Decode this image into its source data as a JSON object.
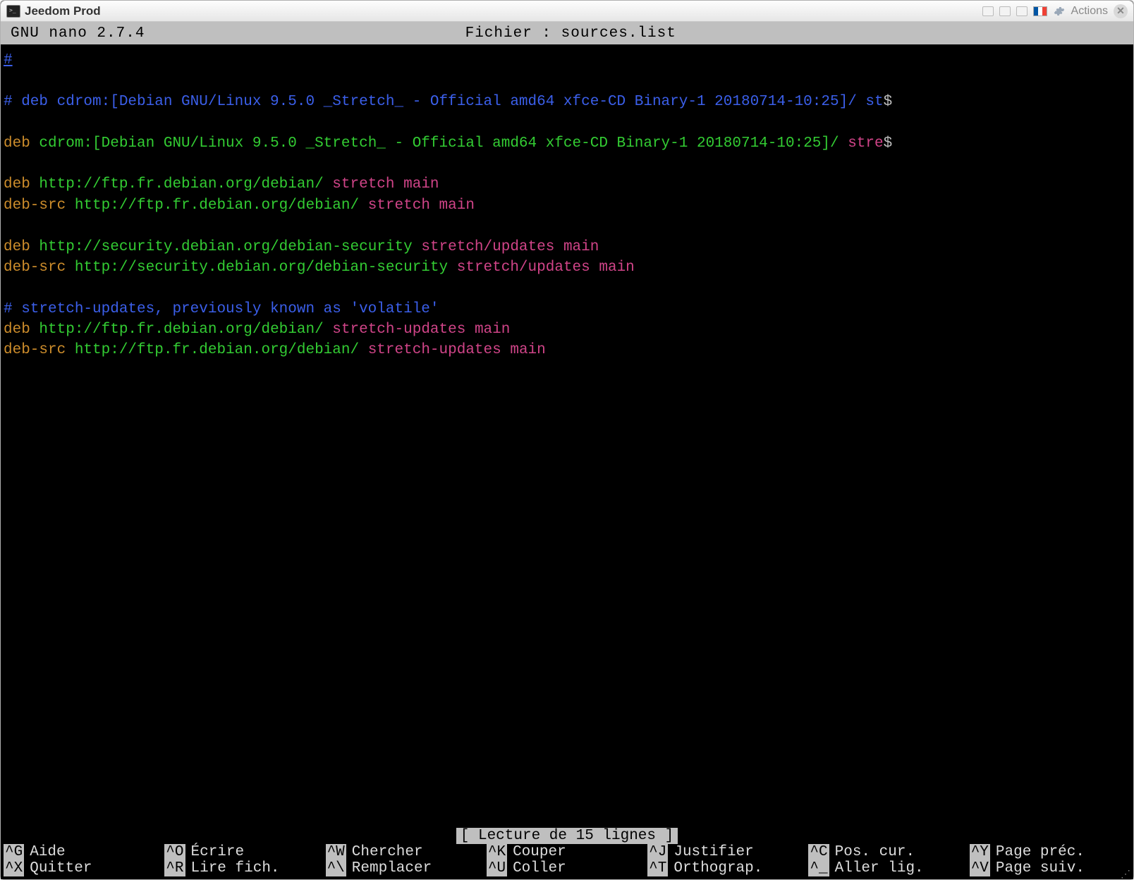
{
  "window": {
    "title": "Jeedom Prod",
    "actions_label": "Actions"
  },
  "nano": {
    "app": "  GNU nano 2.7.4",
    "file_label": "Fichier : sources.list"
  },
  "file_content": {
    "lines": [
      {
        "type": "comment-uline",
        "text": "#"
      },
      {
        "type": "blank",
        "text": ""
      },
      {
        "type": "comment",
        "text": "# deb cdrom:[Debian GNU/Linux 9.5.0 _Stretch_ - Official amd64 xfce-CD Binary-1 20180714-10:25]/ st",
        "trunc": "$"
      },
      {
        "type": "blank",
        "text": ""
      },
      {
        "type": "deb",
        "deb": "deb",
        "args": " cdrom:[Debian GNU/Linux 9.5.0 _Stretch_ - Official amd64 xfce-CD Binary-1 20180714-10:25]/ ",
        "dist": "stre",
        "trunc": "$"
      },
      {
        "type": "blank",
        "text": ""
      },
      {
        "type": "deb",
        "deb": "deb",
        "args": " http://ftp.fr.debian.org/debian/ ",
        "dist": "stretch ",
        "comp": "main"
      },
      {
        "type": "deb",
        "deb": "deb-src",
        "args": " http://ftp.fr.debian.org/debian/ ",
        "dist": "stretch ",
        "comp": "main"
      },
      {
        "type": "blank",
        "text": ""
      },
      {
        "type": "deb",
        "deb": "deb",
        "args": " http://security.debian.org/debian-security ",
        "dist": "stretch/updates ",
        "comp": "main"
      },
      {
        "type": "deb",
        "deb": "deb-src",
        "args": " http://security.debian.org/debian-security ",
        "dist": "stretch/updates ",
        "comp": "main"
      },
      {
        "type": "blank",
        "text": ""
      },
      {
        "type": "comment",
        "text": "# stretch-updates, previously known as 'volatile'"
      },
      {
        "type": "deb",
        "deb": "deb",
        "args": " http://ftp.fr.debian.org/debian/ ",
        "dist": "stretch-updates ",
        "comp": "main"
      },
      {
        "type": "deb",
        "deb": "deb-src",
        "args": " http://ftp.fr.debian.org/debian/ ",
        "dist": "stretch-updates ",
        "comp": "main"
      }
    ]
  },
  "status": {
    "message": "[ Lecture de 15 lignes ]"
  },
  "shortcuts": {
    "row1": [
      {
        "key": "^G",
        "label": "Aide"
      },
      {
        "key": "^O",
        "label": "Écrire"
      },
      {
        "key": "^W",
        "label": "Chercher"
      },
      {
        "key": "^K",
        "label": "Couper"
      },
      {
        "key": "^J",
        "label": "Justifier"
      },
      {
        "key": "^C",
        "label": "Pos. cur."
      },
      {
        "key": "^Y",
        "label": "Page préc."
      }
    ],
    "row2": [
      {
        "key": "^X",
        "label": "Quitter"
      },
      {
        "key": "^R",
        "label": "Lire fich."
      },
      {
        "key": "^\\",
        "label": "Remplacer"
      },
      {
        "key": "^U",
        "label": "Coller"
      },
      {
        "key": "^T",
        "label": "Orthograp."
      },
      {
        "key": "^_",
        "label": "Aller lig."
      },
      {
        "key": "^V",
        "label": "Page suiv."
      }
    ]
  }
}
